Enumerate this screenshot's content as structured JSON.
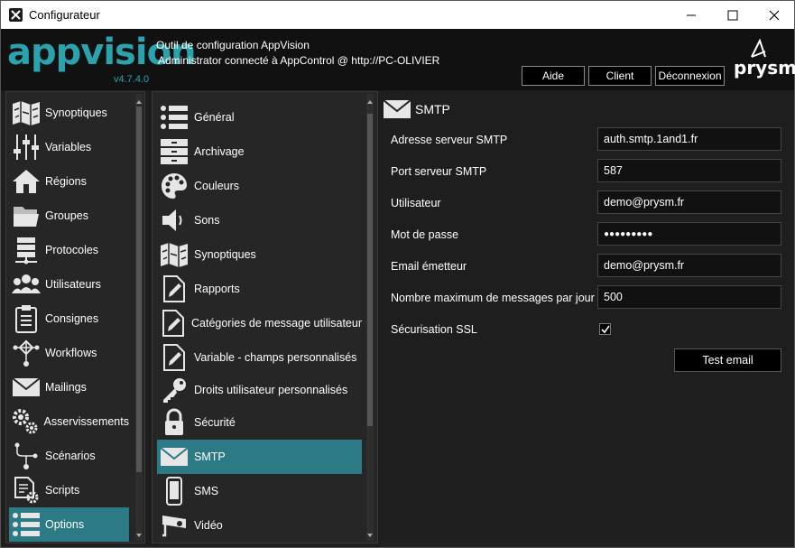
{
  "window": {
    "title": "Configurateur"
  },
  "header": {
    "logo": "appvision",
    "version": "v4.7.4.0",
    "line1": "Outil de configuration AppVision",
    "line2": "Administrator connecté à AppControl @ http://PC-OLIVIER",
    "buttons": {
      "help": "Aide",
      "client": "Client",
      "logout": "Déconnexion"
    },
    "brand": "prysm"
  },
  "sidebar": {
    "items": [
      {
        "label": "Synoptiques",
        "icon": "map-icon"
      },
      {
        "label": "Variables",
        "icon": "sliders-icon"
      },
      {
        "label": "Régions",
        "icon": "house-icon"
      },
      {
        "label": "Groupes",
        "icon": "folder-icon"
      },
      {
        "label": "Protocoles",
        "icon": "server-network-icon"
      },
      {
        "label": "Utilisateurs",
        "icon": "users-icon"
      },
      {
        "label": "Consignes",
        "icon": "clipboard-icon"
      },
      {
        "label": "Workflows",
        "icon": "workflow-icon"
      },
      {
        "label": "Mailings",
        "icon": "envelope-icon"
      },
      {
        "label": "Asservissements",
        "icon": "gears-icon"
      },
      {
        "label": "Scénarios",
        "icon": "flow-icon"
      },
      {
        "label": "Scripts",
        "icon": "script-gear-icon"
      },
      {
        "label": "Options",
        "icon": "list-icon",
        "selected": true
      }
    ]
  },
  "options_list": {
    "items": [
      {
        "label": "Général",
        "icon": "list-icon"
      },
      {
        "label": "Archivage",
        "icon": "archive-icon"
      },
      {
        "label": "Couleurs",
        "icon": "palette-icon"
      },
      {
        "label": "Sons",
        "icon": "speaker-icon"
      },
      {
        "label": "Synoptiques",
        "icon": "map-icon"
      },
      {
        "label": "Rapports",
        "icon": "document-edit-icon"
      },
      {
        "label": "Catégories de message utilisateur",
        "icon": "document-edit-icon"
      },
      {
        "label": "Variable - champs personnalisés",
        "icon": "document-edit-icon"
      },
      {
        "label": "Droits utilisateur personnalisés",
        "icon": "key-icon"
      },
      {
        "label": "Sécurité",
        "icon": "lock-icon"
      },
      {
        "label": "SMTP",
        "icon": "envelope-icon",
        "selected": true
      },
      {
        "label": "SMS",
        "icon": "phone-icon"
      },
      {
        "label": "Vidéo",
        "icon": "camera-icon"
      }
    ]
  },
  "smtp": {
    "title": "SMTP",
    "fields": [
      {
        "label": "Adresse serveur SMTP",
        "value": "auth.smtp.1and1.fr"
      },
      {
        "label": "Port serveur SMTP",
        "value": "587"
      },
      {
        "label": "Utilisateur",
        "value": "demo@prysm.fr"
      },
      {
        "label": "Mot de passe",
        "value": "●●●●●●●●●"
      },
      {
        "label": "Email émetteur",
        "value": "demo@prysm.fr"
      },
      {
        "label": "Nombre maximum de messages par jour",
        "value": "500"
      }
    ],
    "ssl_label": "Sécurisation SSL",
    "ssl_checked": true,
    "test_button": "Test email"
  },
  "colors": {
    "accent": "#2b7a85",
    "logo": "#2aa3ad",
    "background": "#1e1e1e"
  }
}
